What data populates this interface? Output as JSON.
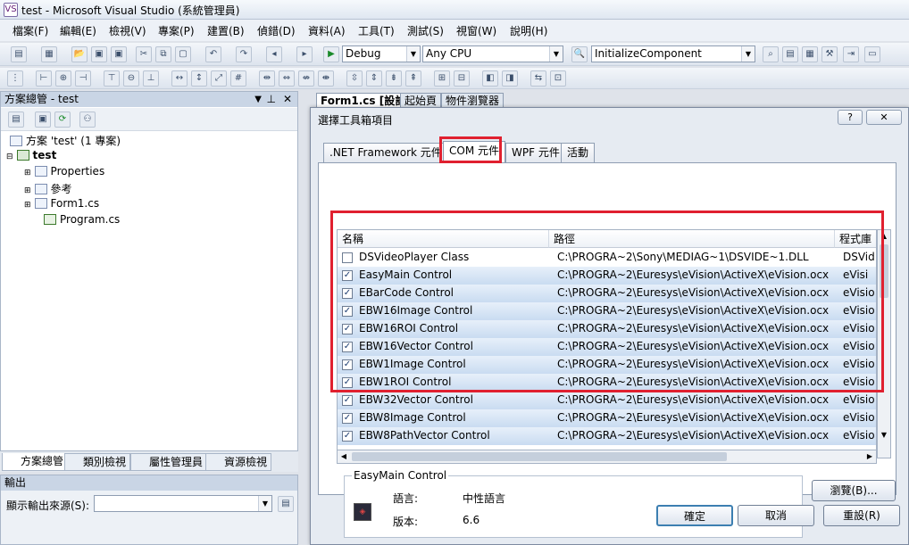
{
  "window": {
    "title": "test - Microsoft Visual Studio (系統管理員)"
  },
  "menu": [
    "檔案(F)",
    "編輯(E)",
    "檢視(V)",
    "專案(P)",
    "建置(B)",
    "偵錯(D)",
    "資料(A)",
    "工具(T)",
    "測試(S)",
    "視窗(W)",
    "說明(H)"
  ],
  "toolbar": {
    "config": "Debug",
    "platform": "Any CPU",
    "find": "InitializeComponent"
  },
  "solution_explorer": {
    "title": "方案總管 - test",
    "solution": "方案 'test' (1 專案)",
    "project": "test",
    "items": [
      "Properties",
      "參考",
      "Form1.cs",
      "Program.cs"
    ],
    "tabs": [
      "方案總管",
      "類別檢視",
      "屬性管理員",
      "資源檢視"
    ]
  },
  "output": {
    "title": "輸出",
    "source_label": "顯示輸出來源(S):"
  },
  "doc_tabs": [
    "Form1.cs [設計]",
    "起始頁",
    "物件瀏覽器"
  ],
  "dialog": {
    "title": "選擇工具箱項目",
    "help": "?",
    "tabs": [
      ".NET Framework 元件",
      "COM 元件",
      "WPF 元件",
      "活動"
    ],
    "active_tab": "COM 元件",
    "columns": [
      "名稱",
      "路徑",
      "程式庫"
    ],
    "rows": [
      {
        "name": "DSVideoPlayer Class",
        "path": "C:\\PROGRA~2\\Sony\\MEDIAG~1\\DSVIDE~1.DLL",
        "lib": "DSVid",
        "checked": false
      },
      {
        "name": "EasyMain Control",
        "path": "C:\\PROGRA~2\\Euresys\\eVision\\ActiveX\\eVision.ocx",
        "lib": "eVisi",
        "checked": true
      },
      {
        "name": "EBarCode Control",
        "path": "C:\\PROGRA~2\\Euresys\\eVision\\ActiveX\\eVision.ocx",
        "lib": "eVisio",
        "checked": true
      },
      {
        "name": "EBW16Image Control",
        "path": "C:\\PROGRA~2\\Euresys\\eVision\\ActiveX\\eVision.ocx",
        "lib": "eVisio",
        "checked": true
      },
      {
        "name": "EBW16ROI Control",
        "path": "C:\\PROGRA~2\\Euresys\\eVision\\ActiveX\\eVision.ocx",
        "lib": "eVisio",
        "checked": true
      },
      {
        "name": "EBW16Vector Control",
        "path": "C:\\PROGRA~2\\Euresys\\eVision\\ActiveX\\eVision.ocx",
        "lib": "eVisio",
        "checked": true
      },
      {
        "name": "EBW1Image Control",
        "path": "C:\\PROGRA~2\\Euresys\\eVision\\ActiveX\\eVision.ocx",
        "lib": "eVisio",
        "checked": true
      },
      {
        "name": "EBW1ROI Control",
        "path": "C:\\PROGRA~2\\Euresys\\eVision\\ActiveX\\eVision.ocx",
        "lib": "eVisio",
        "checked": true
      },
      {
        "name": "EBW32Vector Control",
        "path": "C:\\PROGRA~2\\Euresys\\eVision\\ActiveX\\eVision.ocx",
        "lib": "eVisio",
        "checked": true
      },
      {
        "name": "EBW8Image Control",
        "path": "C:\\PROGRA~2\\Euresys\\eVision\\ActiveX\\eVision.ocx",
        "lib": "eVisio",
        "checked": true
      },
      {
        "name": "EBW8PathVector Control",
        "path": "C:\\PROGRA~2\\Euresys\\eVision\\ActiveX\\eVision.ocx",
        "lib": "eVisio",
        "checked": true
      }
    ],
    "info": {
      "title": "EasyMain Control",
      "lang_label": "語言:",
      "lang_value": "中性語言",
      "ver_label": "版本:",
      "ver_value": "6.6"
    },
    "buttons": {
      "browse": "瀏覽(B)...",
      "ok": "確定",
      "cancel": "取消",
      "reset": "重設(R)"
    }
  },
  "colors": {
    "highlight": "#e0202f",
    "selection": "#c9dcf1"
  }
}
